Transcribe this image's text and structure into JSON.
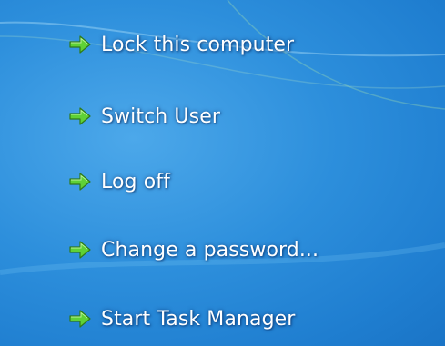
{
  "screen": {
    "background_color": "#2d8fdc",
    "arrow_icon": "green-right-arrow-icon",
    "arrow_color": "#5fd136"
  },
  "menu": {
    "items": [
      {
        "label": "Lock this computer"
      },
      {
        "label": "Switch User"
      },
      {
        "label": "Log off"
      },
      {
        "label": "Change a password..."
      },
      {
        "label": "Start Task Manager"
      }
    ]
  }
}
